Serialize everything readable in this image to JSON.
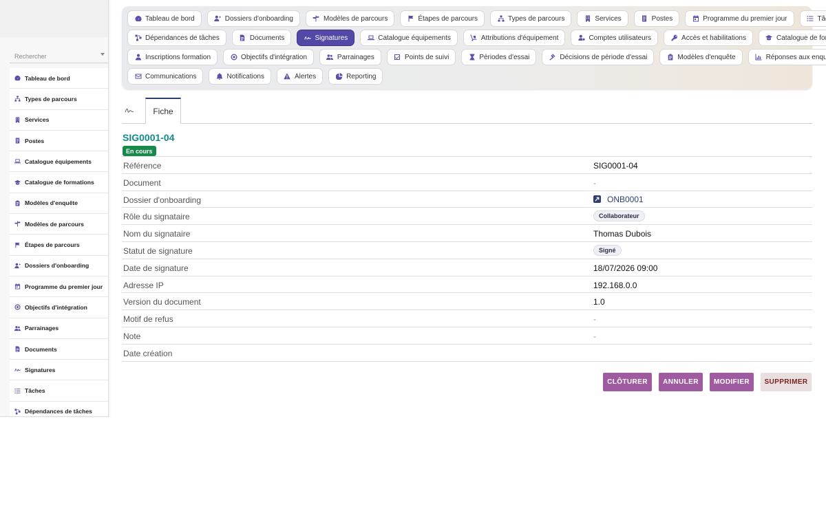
{
  "sidebar": {
    "search_placeholder": "Rechercher",
    "items": [
      {
        "label": "Tableau de bord",
        "icon": "dashboard-icon"
      },
      {
        "label": "Types de parcours",
        "icon": "sitemap-icon"
      },
      {
        "label": "Services",
        "icon": "building-icon"
      },
      {
        "label": "Postes",
        "icon": "badge-icon"
      },
      {
        "label": "Catalogue équipements",
        "icon": "laptop-icon"
      },
      {
        "label": "Catalogue de formations",
        "icon": "graduation-cap-icon"
      },
      {
        "label": "Modèles d'enquête",
        "icon": "clipboard-icon"
      },
      {
        "label": "Modèles de parcours",
        "icon": "signpost-icon"
      },
      {
        "label": "Étapes de parcours",
        "icon": "flag-icon"
      },
      {
        "label": "Dossiers d'onboarding",
        "icon": "user-plus-icon"
      },
      {
        "label": "Programme du premier jour",
        "icon": "calendar-icon"
      },
      {
        "label": "Objectifs d'intégration",
        "icon": "target-icon"
      },
      {
        "label": "Parrainages",
        "icon": "users-icon"
      },
      {
        "label": "Documents",
        "icon": "document-icon"
      },
      {
        "label": "Signatures",
        "icon": "signature-icon"
      },
      {
        "label": "Tâches",
        "icon": "list-icon"
      },
      {
        "label": "Dépendances de tâches",
        "icon": "diagram-icon"
      }
    ]
  },
  "topnav": {
    "rows": [
      [
        {
          "label": "Tableau de bord",
          "icon": "dashboard-icon"
        },
        {
          "label": "Dossiers d'onboarding",
          "icon": "user-plus-icon"
        },
        {
          "label": "Modèles de parcours",
          "icon": "signpost-icon"
        },
        {
          "label": "Étapes de parcours",
          "icon": "flag-icon"
        },
        {
          "label": "Types de parcours",
          "icon": "sitemap-icon"
        },
        {
          "label": "Services",
          "icon": "building-icon"
        },
        {
          "label": "Postes",
          "icon": "badge-icon"
        },
        {
          "label": "Programme du premier jour",
          "icon": "calendar-icon"
        },
        {
          "label": "Tâches",
          "icon": "list-icon"
        }
      ],
      [
        {
          "label": "Dépendances de tâches",
          "icon": "diagram-icon"
        },
        {
          "label": "Documents",
          "icon": "document-icon"
        },
        {
          "label": "Signatures",
          "icon": "signature-icon",
          "active": true
        },
        {
          "label": "Catalogue équipements",
          "icon": "laptop-icon"
        },
        {
          "label": "Attributions d'équipement",
          "icon": "dolly-icon"
        },
        {
          "label": "Comptes utilisateurs",
          "icon": "user-gear-icon"
        },
        {
          "label": "Accès et habilitations",
          "icon": "key-icon"
        },
        {
          "label": "Catalogue de formations",
          "icon": "graduation-cap-icon"
        }
      ],
      [
        {
          "label": "Inscriptions formation",
          "icon": "user-tie-icon"
        },
        {
          "label": "Objectifs d'intégration",
          "icon": "target-icon"
        },
        {
          "label": "Parrainages",
          "icon": "users-icon"
        },
        {
          "label": "Points de suivi",
          "icon": "check-square-icon"
        },
        {
          "label": "Périodes d'essai",
          "icon": "hourglass-icon"
        },
        {
          "label": "Décisions de période d'essai",
          "icon": "gavel-icon"
        },
        {
          "label": "Modèles d'enquête",
          "icon": "clipboard-icon"
        },
        {
          "label": "Réponses aux enquêtes",
          "icon": "chart-icon"
        }
      ],
      [
        {
          "label": "Communications",
          "icon": "envelope-icon"
        },
        {
          "label": "Notifications",
          "icon": "bell-icon"
        },
        {
          "label": "Alertes",
          "icon": "warning-icon"
        },
        {
          "label": "Reporting",
          "icon": "pie-chart-icon"
        }
      ]
    ]
  },
  "tabs": {
    "fiche_label": "Fiche"
  },
  "record": {
    "title": "SIG0001-04",
    "status": "En cours",
    "fields": [
      {
        "label": "Référence",
        "value": "SIG0001-04",
        "kind": "text"
      },
      {
        "label": "Document",
        "value": "-",
        "kind": "dash"
      },
      {
        "label": "Dossier d'onboarding",
        "value": "ONB0001",
        "kind": "link"
      },
      {
        "label": "Rôle du signataire",
        "value": "Collaborateur",
        "kind": "chip"
      },
      {
        "label": "Nom du signataire",
        "value": "Thomas Dubois",
        "kind": "text"
      },
      {
        "label": "Statut de signature",
        "value": "Signé",
        "kind": "chip"
      },
      {
        "label": "Date de signature",
        "value": "18/07/2026 09:00",
        "kind": "text"
      },
      {
        "label": "Adresse IP",
        "value": "192.168.0.0",
        "kind": "text"
      },
      {
        "label": "Version du document",
        "value": "1.0",
        "kind": "text"
      },
      {
        "label": "Motif de refus",
        "value": "-",
        "kind": "dash"
      },
      {
        "label": "Note",
        "value": "-",
        "kind": "dash"
      },
      {
        "label": "Date création",
        "value": "",
        "kind": "text"
      }
    ]
  },
  "actions": {
    "close_label": "CLÔTURER",
    "cancel_label": "ANNULER",
    "edit_label": "MODIFIER",
    "delete_label": "SUPPRIMER"
  },
  "colors": {
    "accent": "#5248a6",
    "title": "#138a8a",
    "status_badge": "#168a4a",
    "action": "#a05aa0",
    "delete_bg": "#eadfdf"
  }
}
